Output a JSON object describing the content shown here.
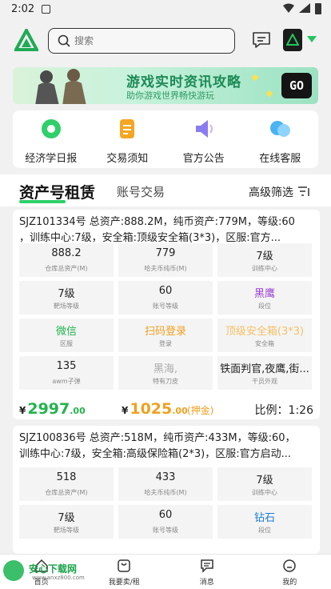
{
  "status_bar": {
    "time": "2:02"
  },
  "header": {
    "search_placeholder": "搜索"
  },
  "banner": {
    "title": "游戏实时资讯攻略",
    "subtitle": "助你游戏世界畅快游玩",
    "go_label": "GO"
  },
  "quick_menu": [
    {
      "label": "经济学日报",
      "icon": "gear-icon",
      "color": "#2fcf6a"
    },
    {
      "label": "交易须知",
      "icon": "document-icon",
      "color": "#f5a623"
    },
    {
      "label": "官方公告",
      "icon": "megaphone-icon",
      "color": "#8a7cf0"
    },
    {
      "label": "在线客服",
      "icon": "chat-bubble-icon",
      "color": "#4ab3f4"
    }
  ],
  "tabs": {
    "active": "资产号租赁",
    "inactive": "账号交易",
    "filter": "高级筛选"
  },
  "listings": [
    {
      "summary_lines": [
        "SJZ101334号 总资产:888.2M，纯币资产:779M，等级:60",
        "，训练中心:7级，安全箱:顶级安全箱(3*3)，区服:官方..."
      ],
      "cells": [
        {
          "value": "888.2",
          "key": "仓库总资产(M)",
          "style": ""
        },
        {
          "value": "779",
          "key": "哈夫币纯币(M)",
          "style": ""
        },
        {
          "value": "7级",
          "key": "训练中心",
          "style": ""
        },
        {
          "value": "7级",
          "key": "靶场等级",
          "style": ""
        },
        {
          "value": "60",
          "key": "账号等级",
          "style": ""
        },
        {
          "value": "黑鹰",
          "key": "段位",
          "style": "purple"
        },
        {
          "value": "微信",
          "key": "区服",
          "style": "green"
        },
        {
          "value": "扫码登录",
          "key": "登录",
          "style": "orange"
        },
        {
          "value": "顶级安全箱(3*3)",
          "key": "安全箱",
          "style": "orange-light"
        },
        {
          "value": "135",
          "key": "awm子弹",
          "style": ""
        },
        {
          "value": "黑海,",
          "key": "特有刀皮",
          "style": "gray"
        },
        {
          "value": "铁面判官,夜鹰,街...",
          "key": "干员外观",
          "style": ""
        }
      ],
      "price": {
        "currency": "¥",
        "integer": "2997",
        "decimal": ".00"
      },
      "deposit": {
        "currency": "¥",
        "integer": "1025",
        "decimal": ".00",
        "label": "(押金)"
      },
      "ratio": "比例：1:26"
    },
    {
      "summary_lines": [
        "SJZ100836号 总资产:518M，纯币资产:433M，等级:60，",
        "训练中心:7级，安全箱:高级保险箱(2*3)，区服:官方启动..."
      ],
      "cells": [
        {
          "value": "518",
          "key": "仓库总资产(M)",
          "style": ""
        },
        {
          "value": "433",
          "key": "哈夫币纯币(M)",
          "style": ""
        },
        {
          "value": "7级",
          "key": "训练中心",
          "style": ""
        },
        {
          "value": "7级",
          "key": "靶场等级",
          "style": ""
        },
        {
          "value": "60",
          "key": "账号等级",
          "style": ""
        },
        {
          "value": "钻石",
          "key": "段位",
          "style": "blue"
        }
      ]
    }
  ],
  "bottom_nav": [
    {
      "label": "首页",
      "icon": "home-icon"
    },
    {
      "label": "我要卖/租",
      "icon": "sell-icon"
    },
    {
      "label": "消息",
      "icon": "message-icon"
    },
    {
      "label": "我的",
      "icon": "profile-icon"
    }
  ],
  "watermark": {
    "text": "安心下载网",
    "url": "www.anxz800.com"
  }
}
